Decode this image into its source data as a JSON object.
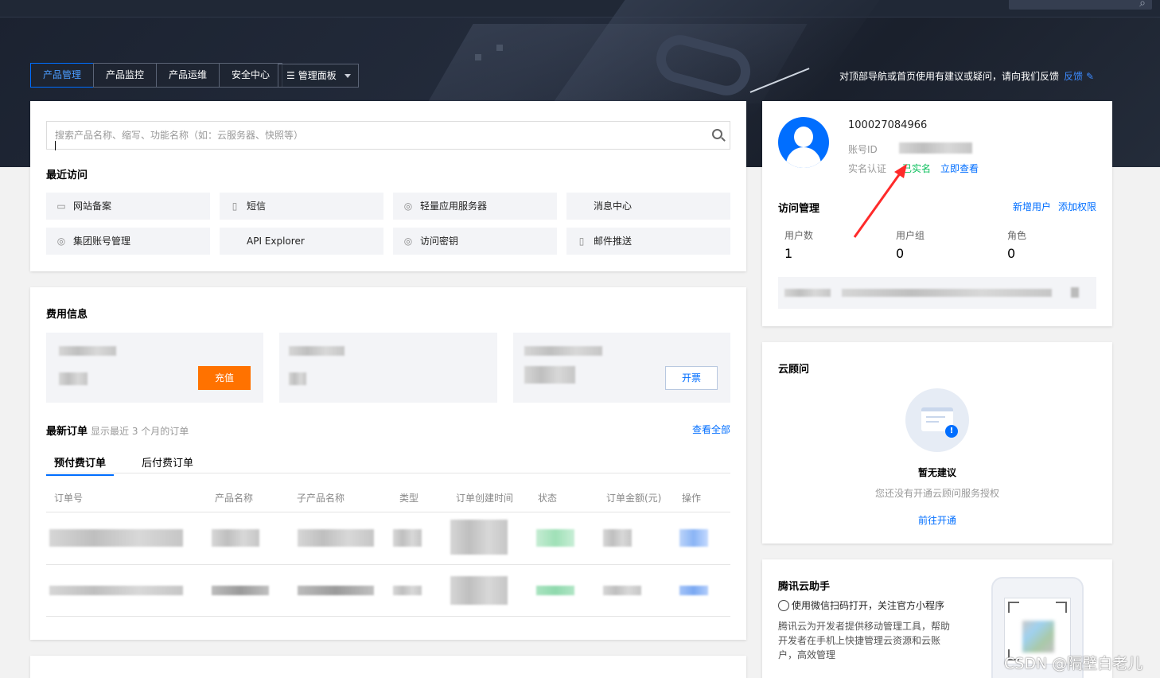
{
  "nav": {
    "tabs": [
      "产品管理",
      "产品监控",
      "产品运维",
      "安全中心"
    ],
    "panel_label": "管理面板",
    "feedback_text": "对顶部导航或首页使用有建议或疑问，请向我们反馈",
    "feedback_link": "反馈"
  },
  "search": {
    "placeholder": "搜索产品名称、缩写、功能名称（如：云服务器、快照等）"
  },
  "recent": {
    "title": "最近访问",
    "items": [
      {
        "label": "网站备案",
        "icon": "filing-icon"
      },
      {
        "label": "短信",
        "icon": "sms-icon"
      },
      {
        "label": "轻量应用服务器",
        "icon": "lighthouse-icon"
      },
      {
        "label": "消息中心",
        "icon": ""
      },
      {
        "label": "集团账号管理",
        "icon": "org-icon"
      },
      {
        "label": "API Explorer",
        "icon": ""
      },
      {
        "label": "访问密钥",
        "icon": "key-icon"
      },
      {
        "label": "邮件推送",
        "icon": "mail-icon"
      }
    ]
  },
  "cost": {
    "title": "费用信息",
    "recharge_label": "充值",
    "invoice_label": "开票"
  },
  "orders": {
    "title": "最新订单",
    "subtitle": "显示最近 3 个月的订单",
    "view_all": "查看全部",
    "tabs": [
      "预付费订单",
      "后付费订单"
    ],
    "columns": [
      "订单号",
      "产品名称",
      "子产品名称",
      "类型",
      "订单创建时间",
      "状态",
      "订单金额(元)",
      "操作"
    ]
  },
  "account": {
    "id": "100027084966",
    "id_label": "账号ID",
    "verify_label": "实名认证",
    "verify_status": "已实名",
    "verify_link": "立即查看"
  },
  "access": {
    "title": "访问管理",
    "add_user": "新增用户",
    "add_perm": "添加权限",
    "stats": [
      {
        "label": "用户数",
        "value": "1"
      },
      {
        "label": "用户组",
        "value": "0"
      },
      {
        "label": "角色",
        "value": "0"
      }
    ]
  },
  "advisor": {
    "title": "云顾问",
    "empty_title": "暂无建议",
    "empty_desc": "您还没有开通云顾问服务授权",
    "action": "前往开通"
  },
  "assistant": {
    "title": "腾讯云助手",
    "line1": "使用微信扫码打开，关注官方小程序",
    "desc_lines": [
      "腾讯云为开发者提供移动管理工具，帮助",
      "开发者在手机上快捷管理云资源和云账",
      "户，高效管理"
    ]
  },
  "watermark": "CSDN @隔壁白老儿",
  "colors": {
    "primary": "#006eff",
    "recharge": "#ff7200",
    "verified": "#0abf5b",
    "annotation": "#ff2a2a"
  }
}
